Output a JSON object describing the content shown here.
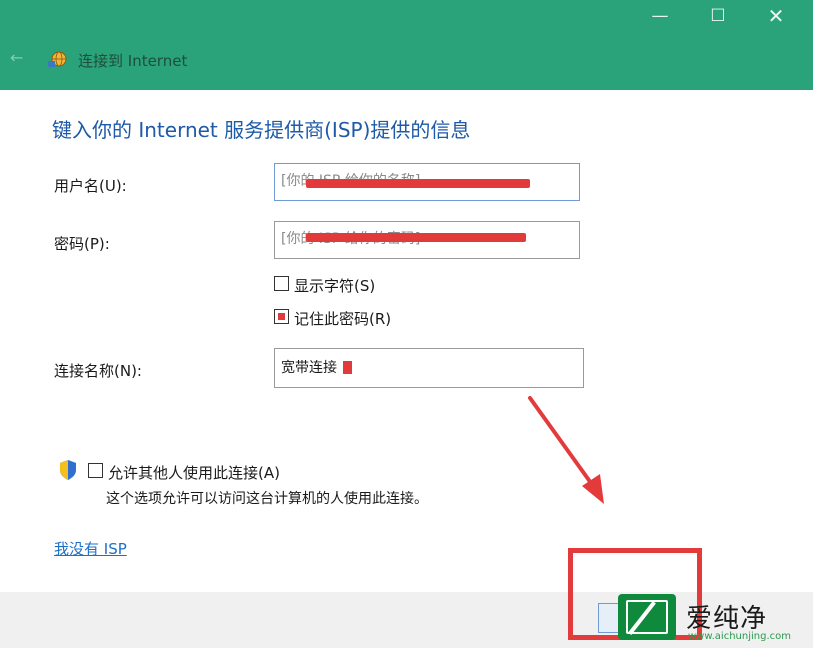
{
  "window": {
    "title": "连接到 Internet",
    "minimize_glyph": "—",
    "maximize_glyph": "☐",
    "close_glyph": "✕",
    "back_glyph": "←"
  },
  "page": {
    "heading": "键入你的 Internet 服务提供商(ISP)提供的信息",
    "username": {
      "label": "用户名(U):",
      "placeholder": "[你的 ISP 给你的名称]"
    },
    "password": {
      "label": "密码(P):",
      "placeholder": "[你的 ISP 给你的密码]"
    },
    "show_chars": {
      "label": "显示字符(S)",
      "checked": false
    },
    "remember_password": {
      "label": "记住此密码(R)",
      "checked": true
    },
    "connection_name": {
      "label": "连接名称(N):",
      "value": "宽带连接"
    },
    "allow_others": {
      "label": "允许其他人使用此连接(A)",
      "description": "这个选项允许可以访问这台计算机的人使用此连接。",
      "checked": false
    },
    "no_isp_link": "我没有 ISP"
  },
  "colors": {
    "titlebar": "#2aa37a",
    "heading": "#1d5aa8",
    "annotation_red": "#e33b3b"
  },
  "icons": {
    "back": "back-arrow-icon",
    "network": "network-globe-icon",
    "shield": "uac-shield-icon"
  },
  "watermark": {
    "brand": "爱纯净",
    "url": "www.aichunjing.com"
  }
}
